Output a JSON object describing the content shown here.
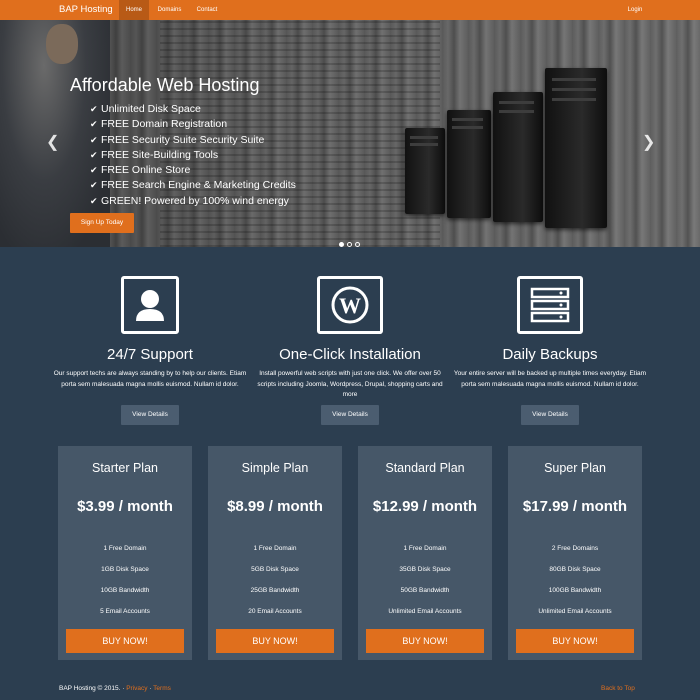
{
  "navbar": {
    "brand": "BAP Hosting",
    "items": [
      {
        "label": "Home",
        "active": true
      },
      {
        "label": "Domains",
        "active": false
      },
      {
        "label": "Contact",
        "active": false
      }
    ],
    "login": "Login",
    "color": "#e06f1d"
  },
  "hero": {
    "title": "Affordable Web Hosting",
    "features": [
      "Unlimited Disk Space",
      "FREE Domain Registration",
      "FREE Security Suite Security Suite",
      "FREE Site-Building Tools",
      "FREE Online Store",
      "FREE Search Engine & Marketing Credits",
      "GREEN! Powered by 100% wind energy"
    ],
    "cta": "Sign Up Today",
    "slides": 3,
    "active_slide": 1
  },
  "features": [
    {
      "icon": "user-icon",
      "title": "24/7 Support",
      "desc": "Our support techs are always standing by to help our clients. Etiam porta sem malesuada magna mollis euismod. Nullam id dolor.",
      "button": "View Details"
    },
    {
      "icon": "wordpress-icon",
      "title": "One-Click Installation",
      "desc": "Install powerful web scripts with just one click. We offer over 50 scripts including Joomla, Wordpress, Drupal, shopping carts and more",
      "button": "View Details"
    },
    {
      "icon": "server-icon",
      "title": "Daily Backups",
      "desc": "Your entire server will be backed up multiple times everyday. Etiam porta sem malesuada magna mollis euismod. Nullam id dolor.",
      "button": "View Details"
    }
  ],
  "plans": [
    {
      "name": "Starter Plan",
      "price": "$3.99 / month",
      "features": [
        "1 Free Domain",
        "1GB Disk Space",
        "10GB Bandwidth",
        "5 Email Accounts"
      ],
      "button": "BUY NOW!"
    },
    {
      "name": "Simple Plan",
      "price": "$8.99 / month",
      "features": [
        "1 Free Domain",
        "5GB Disk Space",
        "25GB Bandwidth",
        "20 Email Accounts"
      ],
      "button": "BUY NOW!"
    },
    {
      "name": "Standard Plan",
      "price": "$12.99 / month",
      "features": [
        "1 Free Domain",
        "35GB Disk Space",
        "50GB Bandwidth",
        "Unlimited Email Accounts"
      ],
      "button": "BUY NOW!"
    },
    {
      "name": "Super Plan",
      "price": "$17.99 / month",
      "features": [
        "2 Free Domains",
        "80GB Disk Space",
        "100GB Bandwidth",
        "Unlimited Email Accounts"
      ],
      "button": "BUY NOW!"
    }
  ],
  "footer": {
    "copyright": "BAP Hosting © 2015. · ",
    "privacy": "Privacy",
    "separator": " · ",
    "terms": "Terms",
    "back_to_top": "Back to Top"
  },
  "colors": {
    "accent": "#e06f1d",
    "background": "#2c3e50",
    "plan_card": "#465768",
    "secondary_button": "#4b5d70"
  }
}
